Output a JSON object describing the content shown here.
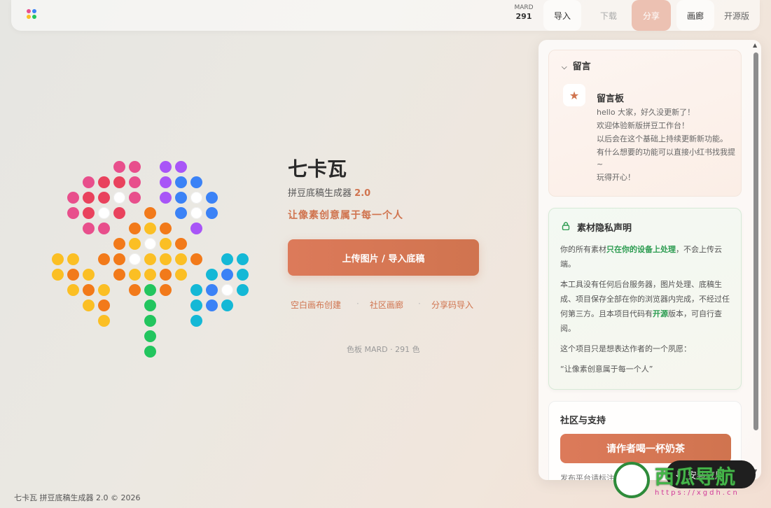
{
  "topbar": {
    "counter_label": "MARD",
    "counter_value": "291",
    "import_label": "导入",
    "download_label": "下载",
    "share_label": "分享",
    "gallery_label": "画廊",
    "opensource_label": "开源版"
  },
  "hero": {
    "title": "七卡瓦",
    "subtitle": "拼豆底稿生成器",
    "version": "2.0",
    "slogan": "让像素创意属于每一个人",
    "upload_label": "上传图片 / 导入底稿",
    "link_blank": "空白画布创建",
    "link_gallery": "社区画廊",
    "link_sharecode": "分享码导入",
    "separator": "·",
    "palette_info": "色板 MARD · 291 色"
  },
  "footer": {
    "text": "七卡瓦 拼豆底稿生成器 2.0 © 2026"
  },
  "panel": {
    "message": {
      "header": "留言",
      "board_title": "留言板",
      "lines": [
        "hello 大家，好久没更新了！",
        "欢迎体验新版拼豆工作台！",
        "以后会在这个基础上持续更新新功能。",
        "有什么想要的功能可以直接小红书找我提~",
        "玩得开心！"
      ]
    },
    "privacy": {
      "title": "素材隐私声明",
      "p1_a": "你的所有素材",
      "p1_b": "只在你的设备上处理",
      "p1_c": "，不会上传云端。",
      "p2_a": "本工具没有任何后台服务器，图片处理、底稿生成、项目保存全部在你的浏览器内完成，不经过任何第三方。且本项目代码有",
      "p2_b": "开源",
      "p2_c": "版本，可自行查阅。",
      "p3": "这个项目只是想表达作者的一个夙愿：",
      "p4": "“让像素创意属于每一个人”"
    },
    "community": {
      "title": "社区与支持",
      "tea_label": "请作者喝一杯奶茶",
      "note": "发布平台请标注出处"
    }
  },
  "overlay": {
    "install_label": "安装应用",
    "watermark_text": "西瓜导航",
    "watermark_url": "https://xgdh.cn"
  },
  "colors": {
    "accent": "#d0744f",
    "share_bg": "#ecc1b2",
    "green": "#2b9b50",
    "pink": "#e84f8c",
    "red": "#e9425d",
    "purple": "#a855f7",
    "blue": "#3b82f6",
    "orange": "#f27a1a",
    "yellow": "#fbbf24",
    "teal": "#14b8d6",
    "leaf": "#22c55e",
    "white": "#ffffff"
  }
}
